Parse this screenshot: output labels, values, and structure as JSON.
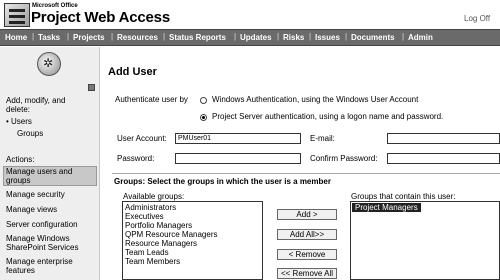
{
  "brand": {
    "small": "Microsoft Office",
    "title": "Project Web Access"
  },
  "header": {
    "logoff": "Log Off"
  },
  "nav": [
    "Home",
    "Tasks",
    "Projects",
    "Resources",
    "Status Reports",
    "Updates",
    "Risks",
    "Issues",
    "Documents",
    "Admin"
  ],
  "sidebar": {
    "heading": [
      "Add, modify, and",
      "delete:"
    ],
    "bullet_users": "• Users",
    "groups": "Groups",
    "actions_label": "Actions:",
    "items": [
      "Manage users and",
      "groups",
      "Manage security",
      "Manage views",
      "Server configuration",
      "Manage Windows",
      "SharePoint Services",
      "Manage enterprise",
      "features"
    ]
  },
  "page": {
    "title": "Add User"
  },
  "auth": {
    "label": "Authenticate user by",
    "option_windows": "Windows Authentication, using the Windows User Account",
    "option_server": "Project Server authentication, using a logon name and password."
  },
  "form": {
    "user_account_label": "User Account:",
    "user_account_value": "PMUser01",
    "email_label": "E-mail:",
    "email_value": "",
    "password_label": "Password:",
    "confirm_password_label": "Confirm Password:"
  },
  "groups": {
    "heading": "Groups: Select the groups in which the user is a member",
    "available_label": "Available groups:",
    "available": [
      "Administrators",
      "Executives",
      "Portfolio Managers",
      "QPM Resource Managers",
      "Resource Managers",
      "Team Leads",
      "Team Members"
    ],
    "member_label": "Groups that contain this user:",
    "member": [
      "Project Managers"
    ],
    "buttons": {
      "add": "Add >",
      "add_all": "Add All>>",
      "remove": "< Remove",
      "remove_all": "<< Remove All"
    }
  }
}
